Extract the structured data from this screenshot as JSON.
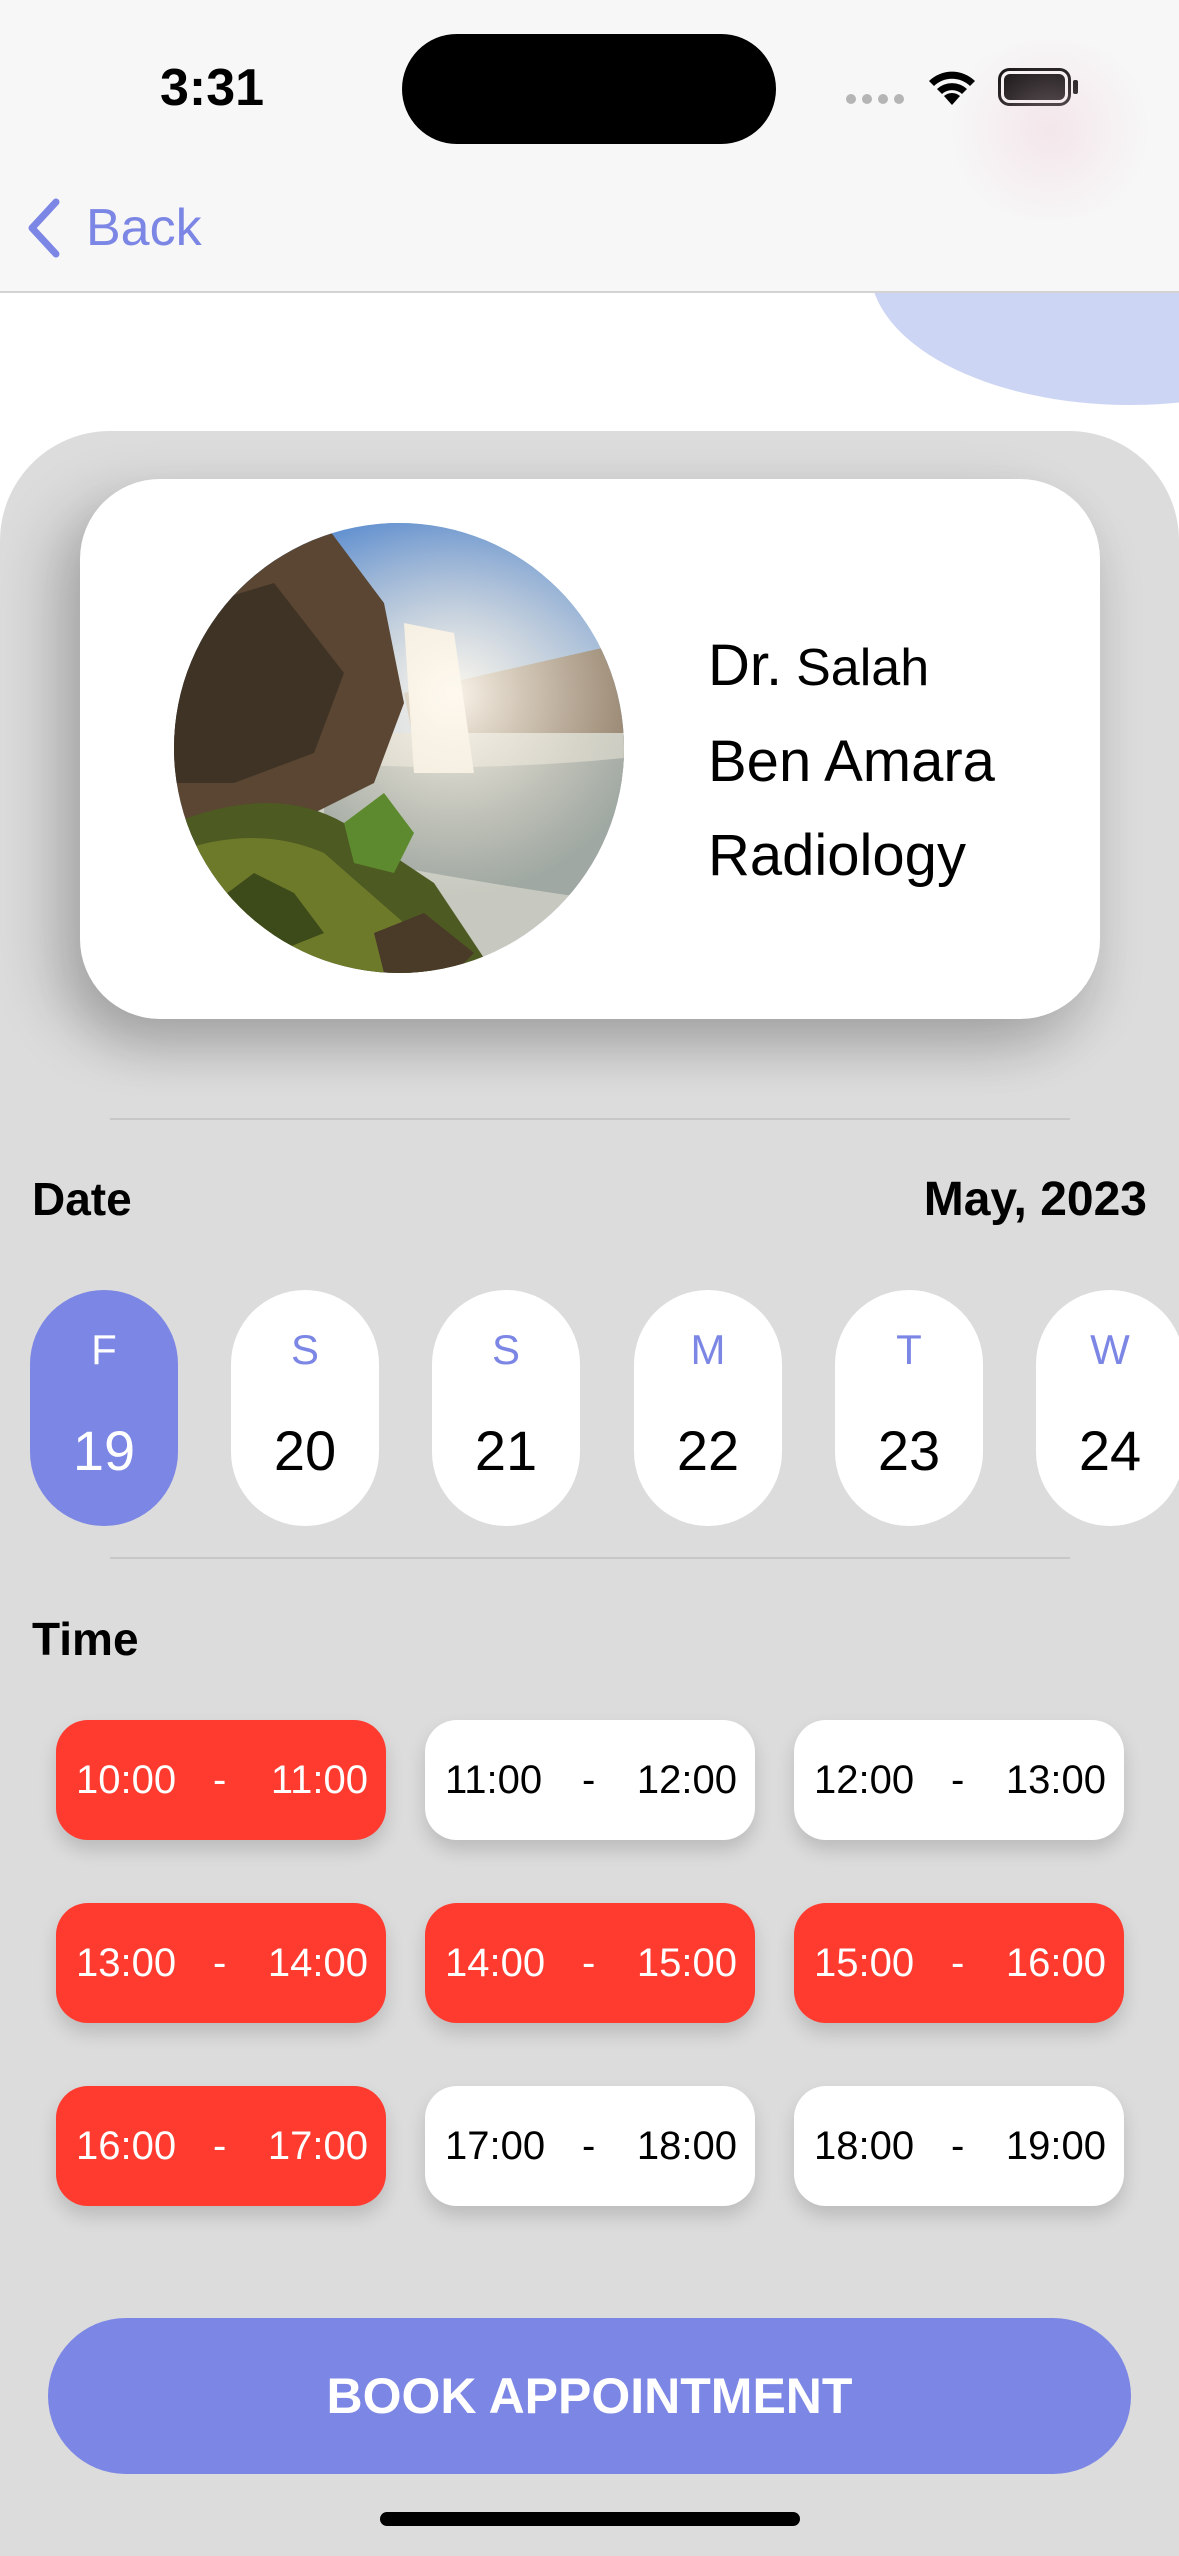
{
  "status_bar": {
    "time": "3:31"
  },
  "nav": {
    "back_label": "Back"
  },
  "doctor": {
    "prefix": "Dr.",
    "first_name": "Salah",
    "last_name": "Ben Amara",
    "specialty": "Radiology",
    "avatar_icon": "waterfall-landscape-photo"
  },
  "date_section": {
    "label": "Date",
    "month": "May, 2023",
    "days": [
      {
        "dow": "F",
        "num": "19",
        "selected": true
      },
      {
        "dow": "S",
        "num": "20",
        "selected": false
      },
      {
        "dow": "S",
        "num": "21",
        "selected": false
      },
      {
        "dow": "M",
        "num": "22",
        "selected": false
      },
      {
        "dow": "T",
        "num": "23",
        "selected": false
      },
      {
        "dow": "W",
        "num": "24",
        "selected": false
      }
    ]
  },
  "time_section": {
    "label": "Time",
    "separator": "-",
    "slots": [
      {
        "from": "10:00",
        "to": "11:00",
        "booked": true
      },
      {
        "from": "11:00",
        "to": "12:00",
        "booked": false
      },
      {
        "from": "12:00",
        "to": "13:00",
        "booked": false
      },
      {
        "from": "13:00",
        "to": "14:00",
        "booked": true
      },
      {
        "from": "14:00",
        "to": "15:00",
        "booked": true
      },
      {
        "from": "15:00",
        "to": "16:00",
        "booked": true
      },
      {
        "from": "16:00",
        "to": "17:00",
        "booked": true
      },
      {
        "from": "17:00",
        "to": "18:00",
        "booked": false
      },
      {
        "from": "18:00",
        "to": "19:00",
        "booked": false
      }
    ]
  },
  "book_button": {
    "label": "BOOK APPOINTMENT"
  },
  "colors": {
    "accent": "#7C86E4",
    "booked": "#FF3B30",
    "panel": "#DCDCDC"
  }
}
